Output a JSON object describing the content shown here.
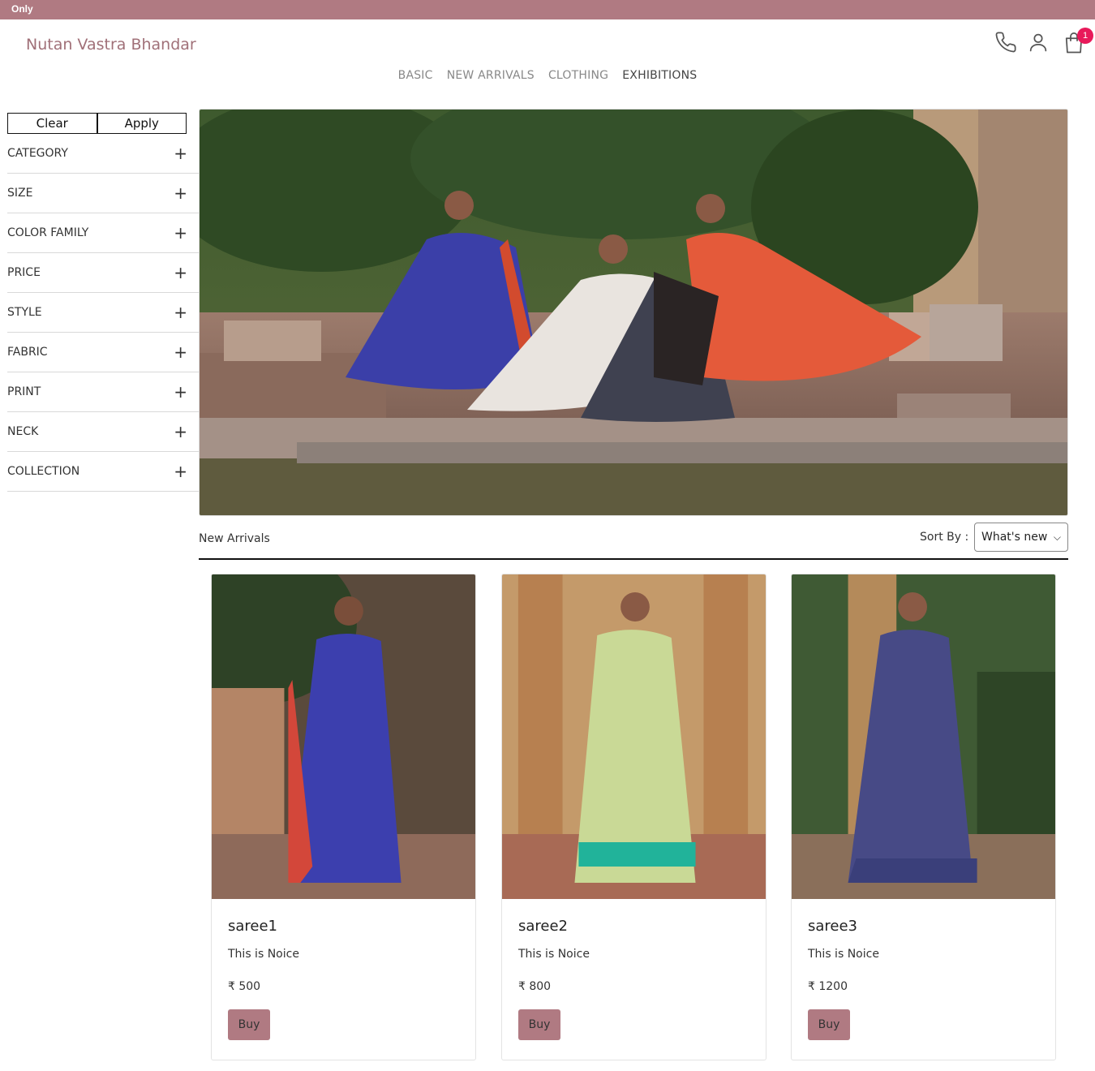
{
  "announcement": "Only",
  "brand": "Nutan Vastra Bhandar",
  "header_icons": [
    "phone-icon",
    "user-icon",
    "cart-icon"
  ],
  "cart_count": "1",
  "nav": [
    "BASIC",
    "NEW ARRIVALS",
    "CLOTHING",
    "EXHIBITIONS"
  ],
  "filter_actions": {
    "clear": "Clear",
    "apply": "Apply"
  },
  "filters": [
    "CATEGORY",
    "SIZE",
    "COLOR FAMILY",
    "PRICE",
    "STYLE",
    "FABRIC",
    "PRINT",
    "NECK",
    "COLLECTION"
  ],
  "filter_toggle": "+",
  "section_title": "New Arrivals",
  "sort": {
    "label": "Sort By :",
    "selected": "What's new"
  },
  "products": [
    {
      "name": "saree1",
      "description": "This is Noice",
      "price": "₹ 500",
      "buy": "Buy"
    },
    {
      "name": "saree2",
      "description": "This is Noice",
      "price": "₹ 800",
      "buy": "Buy"
    },
    {
      "name": "saree3",
      "description": "This is Noice",
      "price": "₹ 1200",
      "buy": "Buy"
    }
  ],
  "colors": {
    "accent": "#b07a82",
    "badge": "#e8195a",
    "brand_text": "#a07078"
  }
}
